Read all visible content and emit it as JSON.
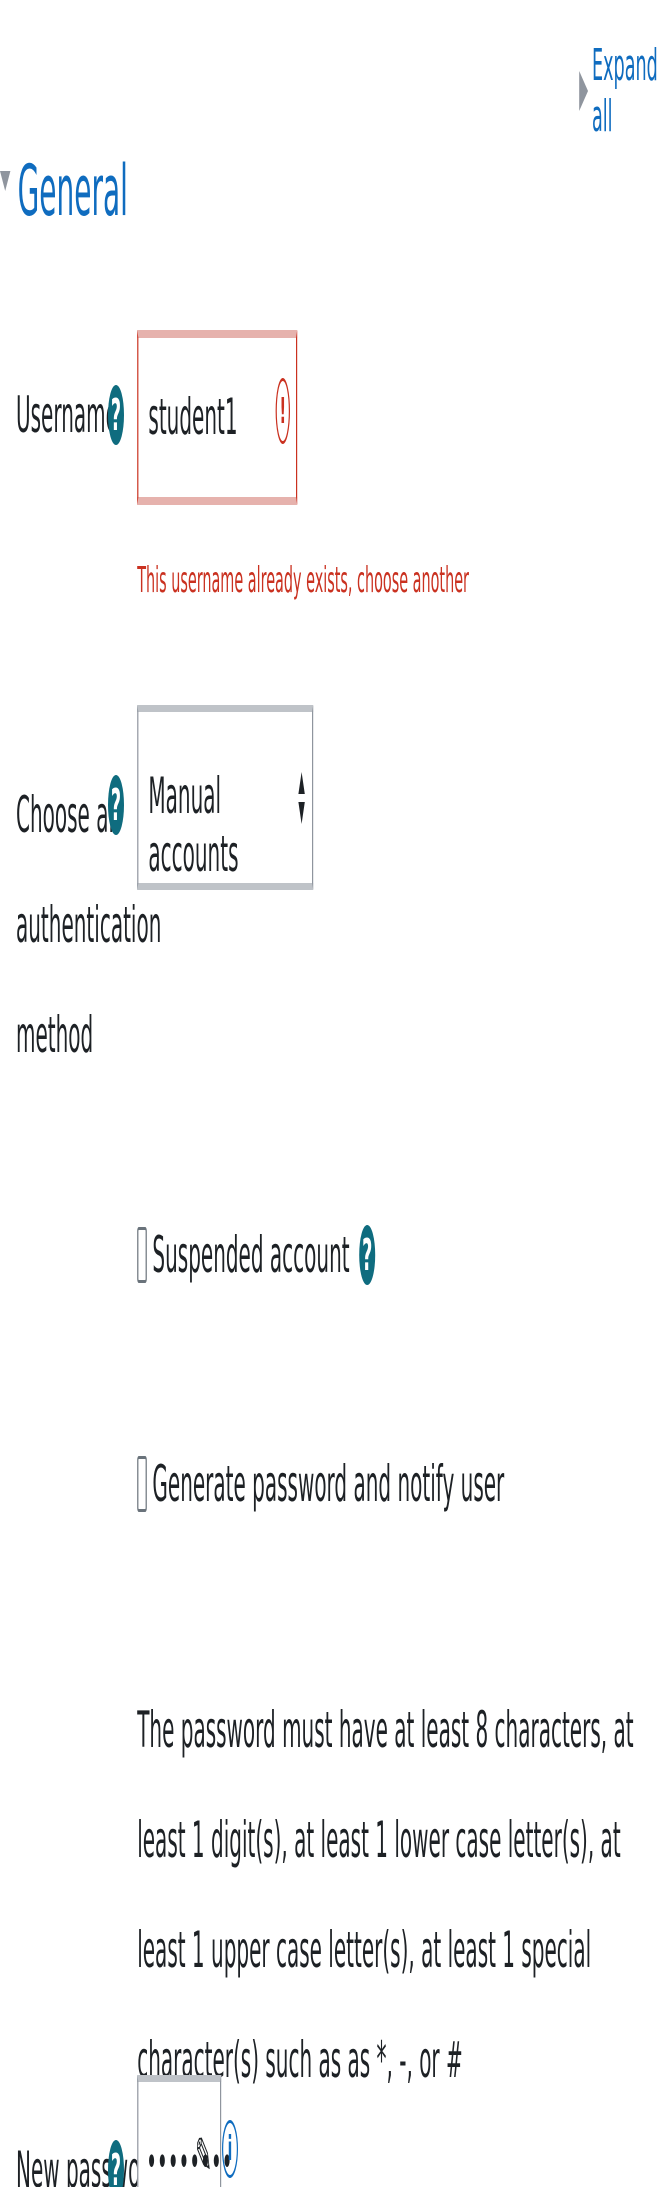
{
  "header": {
    "expand_all": "Expand all"
  },
  "section": {
    "title": "General"
  },
  "form": {
    "username": {
      "label": "Username",
      "value": "student1",
      "error": "This username already exists, choose another"
    },
    "auth": {
      "label_line1": "Choose an",
      "label_line2": "authentication",
      "label_line3": "method",
      "selected": "Manual accounts"
    },
    "suspended": {
      "label": "Suspended account",
      "checked": false
    },
    "generate_password": {
      "label": "Generate password and notify user",
      "checked": false
    },
    "password_policy": "The password must have at least 8 characters, at least 1 digit(s), at least 1 lower case letter(s), at least 1 upper case letter(s), at least 1 special character(s) such as as *, -, or #",
    "new_password": {
      "label": "New password",
      "value": "••••••••"
    }
  },
  "icons": {
    "help": "question-mark-icon",
    "error": "exclamation-icon",
    "edit": "pencil-icon",
    "info": "info-icon"
  },
  "colors": {
    "link": "#0f6cbf",
    "error": "#ca3120",
    "help_icon": "#0f6c7f",
    "text": "#1d2125"
  }
}
